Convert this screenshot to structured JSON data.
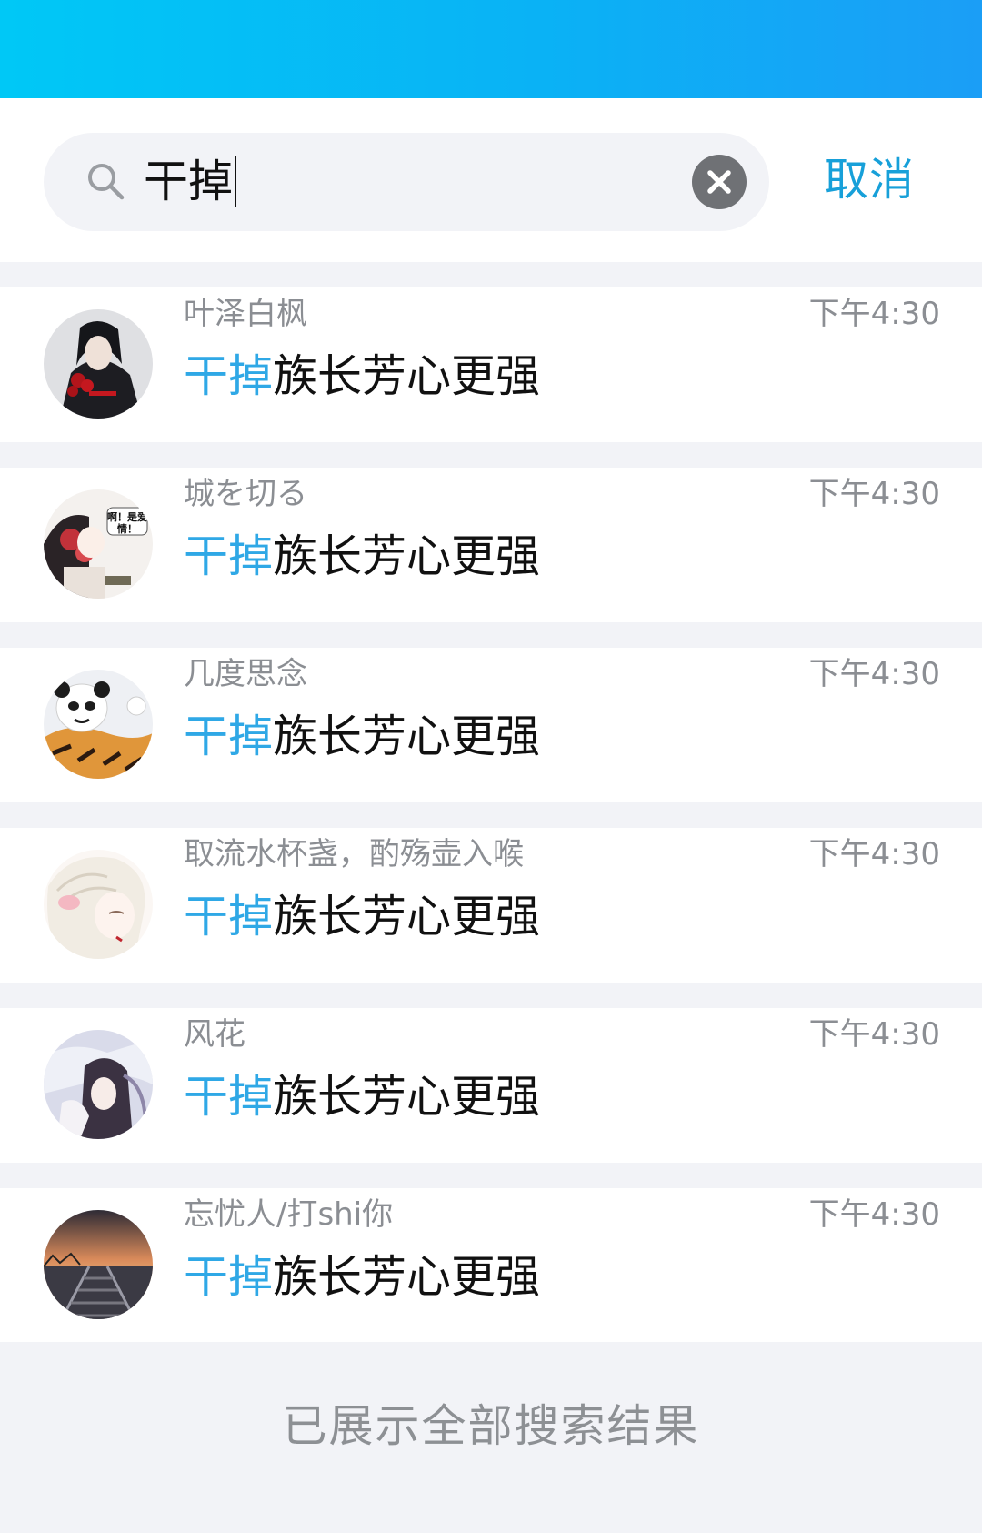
{
  "search": {
    "query": "干掉",
    "cancel_label": "取消"
  },
  "results": [
    {
      "name": "叶泽白枫",
      "time": "下午4:30",
      "match": "干掉",
      "rest": "族长芳心更强",
      "avatar": "dark-robed-figure-avatar"
    },
    {
      "name": "城を切る",
      "time": "下午4:30",
      "match": "干掉",
      "rest": "族长芳心更强",
      "avatar": "chibi-comic-avatar",
      "avatar_text": "啊！是爱情！"
    },
    {
      "name": "几度思念",
      "time": "下午4:30",
      "match": "干掉",
      "rest": "族长芳心更强",
      "avatar": "panda-tiger-meme-avatar"
    },
    {
      "name": "取流水杯盏，酌殇壶入喉",
      "time": "下午4:30",
      "match": "干掉",
      "rest": "族长芳心更强",
      "avatar": "white-haired-anime-avatar"
    },
    {
      "name": "风花",
      "time": "下午4:30",
      "match": "干掉",
      "rest": "族长芳心更强",
      "avatar": "anime-portrait-avatar"
    },
    {
      "name": "忘忧人/打shi你",
      "time": "下午4:30",
      "match": "干掉",
      "rest": "族长芳心更强",
      "avatar": "sunset-railway-avatar"
    }
  ],
  "footer": {
    "text": "已展示全部搜索结果"
  },
  "colors": {
    "accent": "#17a0d9",
    "highlight": "#2fa8e6",
    "header_gradient_start": "#00c8f6",
    "header_gradient_end": "#1b9ef6"
  }
}
